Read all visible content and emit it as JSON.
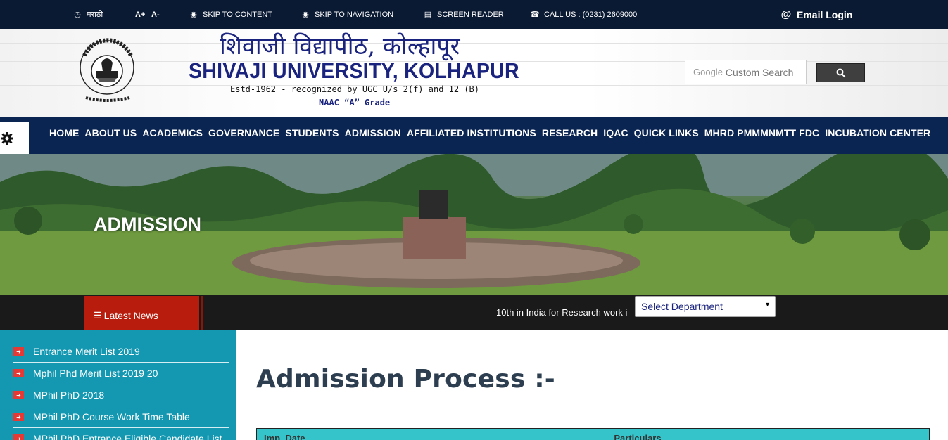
{
  "topbar": {
    "language": "मराठी",
    "font_increase": "A+",
    "font_decrease": "A-",
    "skip_content": "SKIP TO CONTENT",
    "skip_navigation": "SKIP TO NAVIGATION",
    "screen_reader": "SCREEN READER",
    "call_us": "CALL US :  (0231) 2609000",
    "email_login": "Email Login"
  },
  "header": {
    "title_marathi": "शिवाजी विद्यापीठ, कोल्हापूर",
    "title_english": "SHIVAJI UNIVERSITY, KOLHAPUR",
    "established": "Estd-1962 - recognized by UGC U/s 2(f) and 12 (B)",
    "grade": "NAAC “A” Grade",
    "search_brand": "Google",
    "search_placeholder": "Custom Search"
  },
  "nav": {
    "items": [
      "HOME",
      "ABOUT US",
      "ACADEMICS",
      "GOVERNANCE",
      "STUDENTS",
      "ADMISSION",
      "AFFILIATED INSTITUTIONS",
      "RESEARCH",
      "IQAC",
      "QUICK LINKS",
      "MHRD PMMMNMTT FDC",
      "INCUBATION CENTER"
    ]
  },
  "banner": {
    "title": "ADMISSION"
  },
  "news": {
    "label": "Latest News",
    "ticker": "10th in India for Research work i",
    "department_select": "Select Department"
  },
  "sidebar": {
    "items": [
      "Entrance Merit List 2019",
      "Mphil Phd Merit List 2019 20",
      "MPhil PhD 2018",
      "MPhil PhD Course Work Time Table",
      "MPhil PhD Entrance Eligible Candidate List"
    ]
  },
  "main": {
    "heading": "Admission Process :-",
    "table_headers": [
      "Imp. Date",
      "Particulars"
    ]
  },
  "colors": {
    "topbar": "#0b1a33",
    "nav": "#0b2552",
    "latest_news": "#b71c0c",
    "sidebar": "#1498b2",
    "table_header": "#35c4c9"
  }
}
